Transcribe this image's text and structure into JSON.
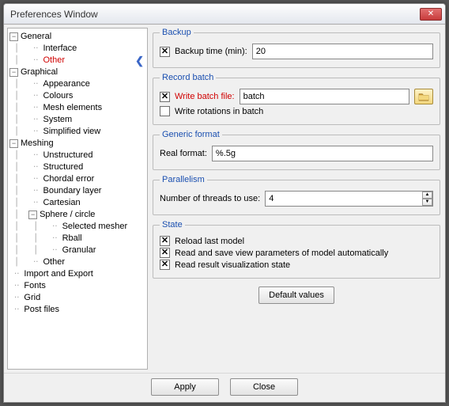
{
  "window": {
    "title": "Preferences Window"
  },
  "tree": {
    "general": {
      "label": "General",
      "expanded": true,
      "children": [
        {
          "label": "Interface"
        },
        {
          "label": "Other",
          "selected": true
        }
      ]
    },
    "graphical": {
      "label": "Graphical",
      "expanded": true,
      "children": [
        {
          "label": "Appearance"
        },
        {
          "label": "Colours"
        },
        {
          "label": "Mesh elements"
        },
        {
          "label": "System"
        },
        {
          "label": "Simplified view"
        }
      ]
    },
    "meshing": {
      "label": "Meshing",
      "expanded": true,
      "children": [
        {
          "label": "Unstructured"
        },
        {
          "label": "Structured"
        },
        {
          "label": "Chordal error"
        },
        {
          "label": "Boundary layer"
        },
        {
          "label": "Cartesian"
        }
      ],
      "sphere": {
        "label": "Sphere / circle",
        "expanded": true,
        "children": [
          {
            "label": "Selected mesher"
          },
          {
            "label": "Rball"
          },
          {
            "label": "Granular"
          }
        ]
      },
      "other": {
        "label": "Other"
      }
    },
    "import_export": {
      "label": "Import and Export"
    },
    "fonts": {
      "label": "Fonts"
    },
    "grid": {
      "label": "Grid"
    },
    "postfiles": {
      "label": "Post files"
    }
  },
  "backup": {
    "legend": "Backup",
    "time_checked": true,
    "time_label": "Backup time (min):",
    "time_value": "20"
  },
  "record": {
    "legend": "Record batch",
    "write_checked": true,
    "write_label": "Write batch file:",
    "write_value": "batch",
    "rot_checked": false,
    "rot_label": "Write rotations in batch"
  },
  "generic": {
    "legend": "Generic format",
    "real_label": "Real format:",
    "real_value": "%.5g"
  },
  "parallel": {
    "legend": "Parallelism",
    "threads_label": "Number of threads to use:",
    "threads_value": "4"
  },
  "state": {
    "legend": "State",
    "reload_checked": true,
    "reload_label": "Reload last model",
    "params_checked": true,
    "params_label": "Read and save view parameters of model automatically",
    "result_checked": true,
    "result_label": "Read result visualization state"
  },
  "buttons": {
    "defaults": "Default values",
    "apply": "Apply",
    "close": "Close"
  },
  "glyphs": {
    "minus": "−",
    "x": "✕",
    "left": "❮",
    "up": "▲",
    "down": "▼"
  }
}
